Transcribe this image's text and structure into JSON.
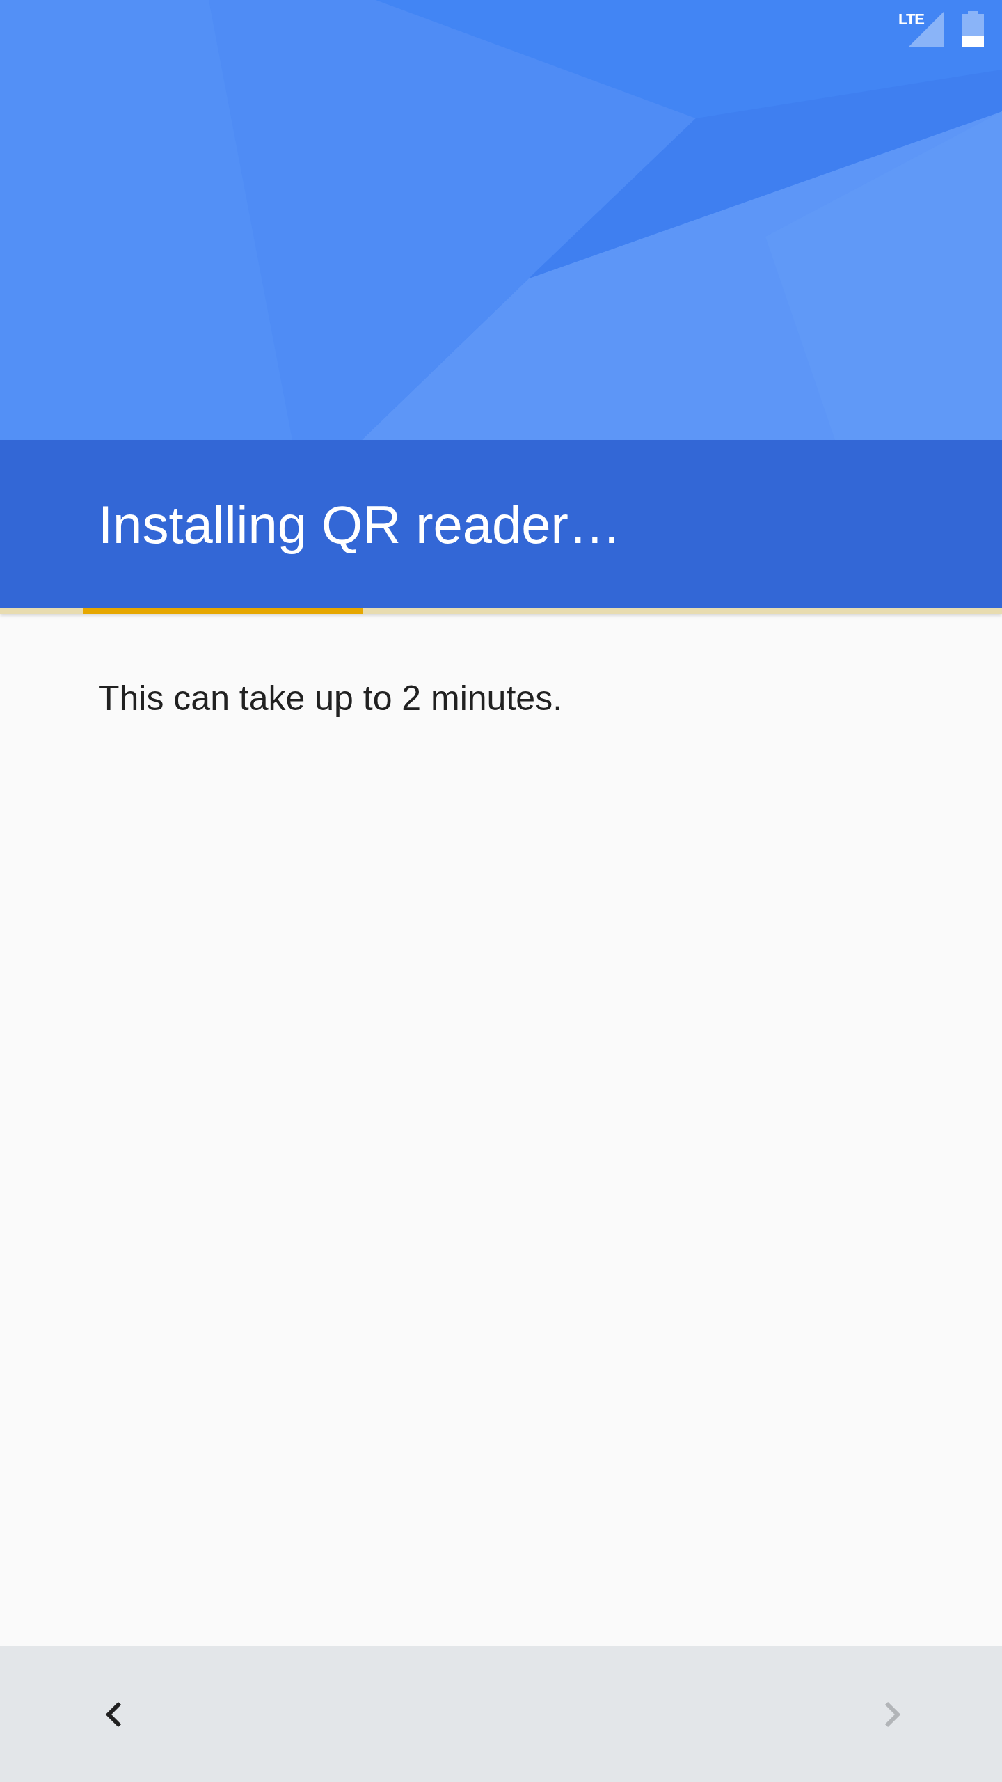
{
  "status_bar": {
    "network": "LTE"
  },
  "header": {
    "title": "Installing QR reader…"
  },
  "progress": {
    "indeterminate": true
  },
  "body": {
    "text": "This can take up to 2 minutes."
  },
  "navigation": [
    {
      "kind": "back",
      "disabled": false
    },
    {
      "kind": "next",
      "disabled": true
    }
  ]
}
